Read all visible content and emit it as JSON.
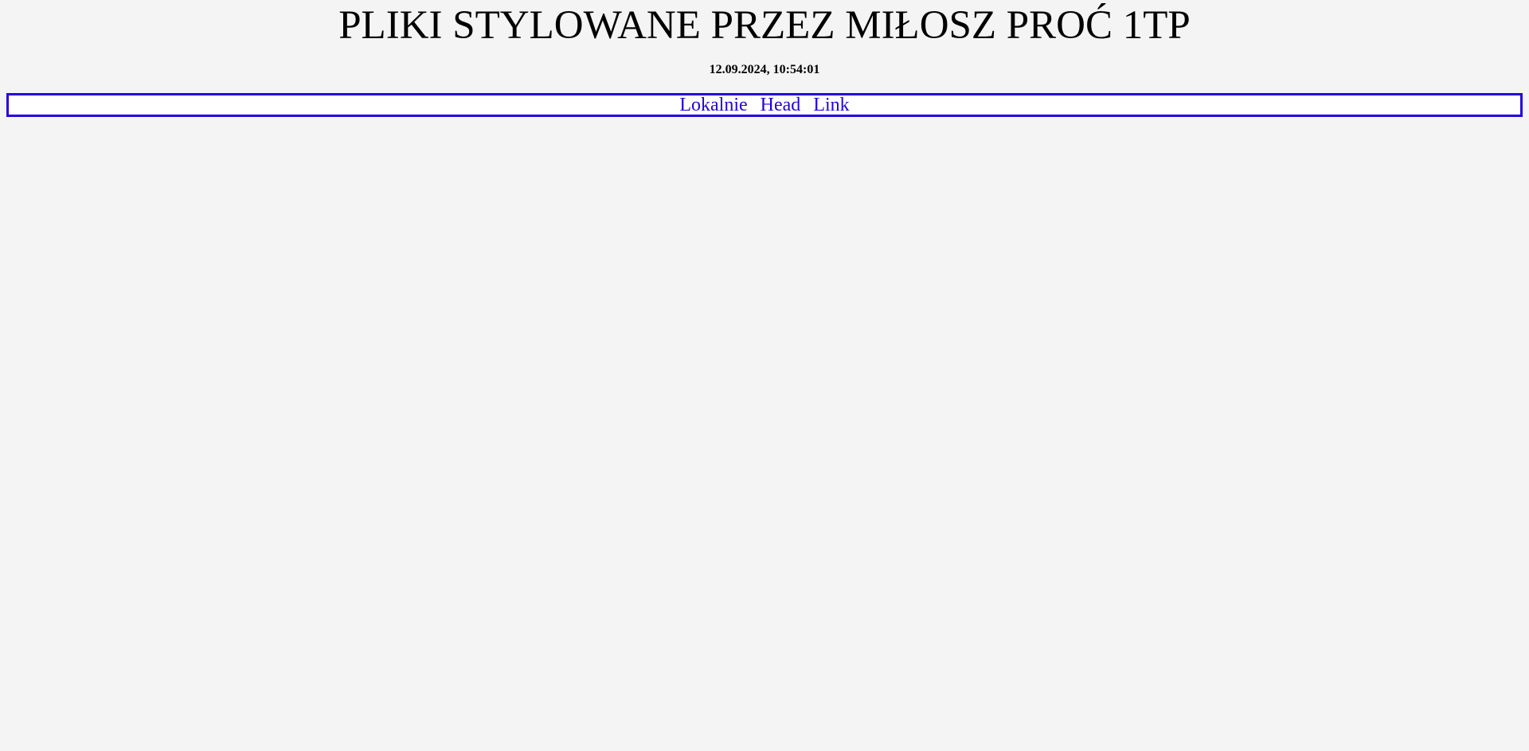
{
  "header": {
    "title": "PLIKI STYLOWANE PRZEZ MIŁOSZ PROĆ 1TP",
    "timestamp": "12.09.2024, 10:54:01"
  },
  "nav": {
    "links": [
      {
        "label": "Lokalnie"
      },
      {
        "label": "Head"
      },
      {
        "label": "Link"
      }
    ]
  },
  "colors": {
    "background": "#f4f4f4",
    "nav_border": "#2200dd",
    "link": "#2200dd",
    "nav_background": "#ffffff"
  }
}
